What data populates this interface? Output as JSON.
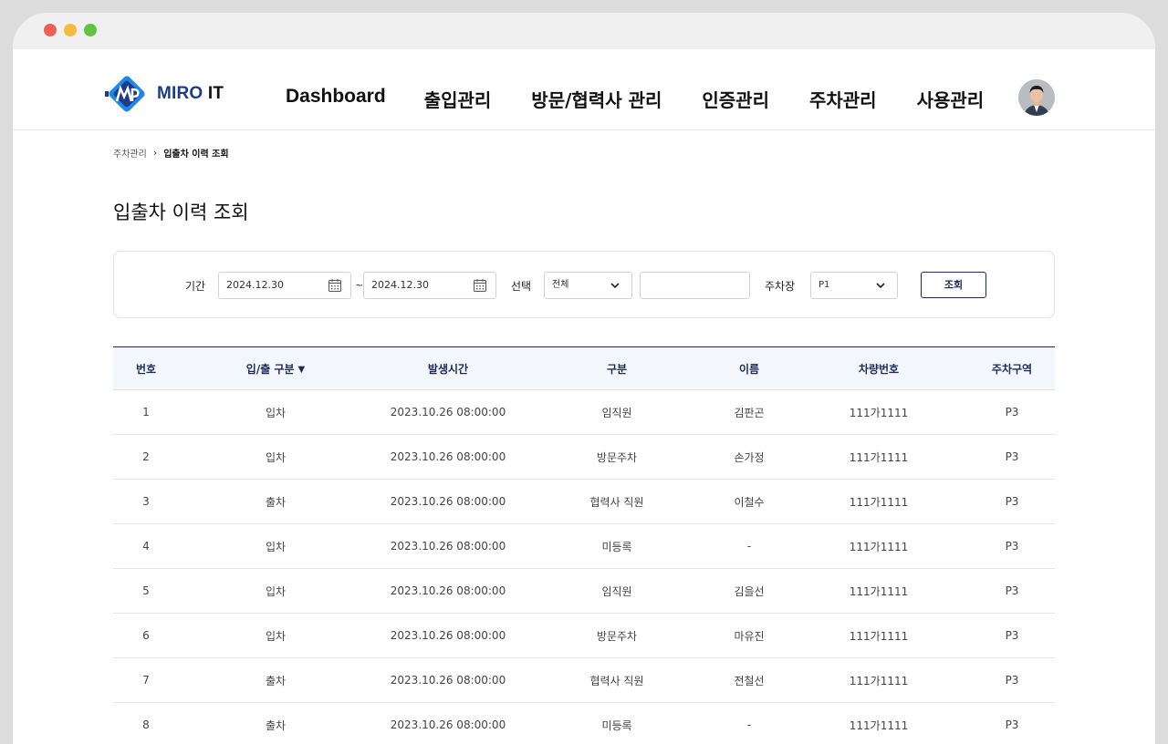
{
  "brand": {
    "name": "MIRO",
    "suffix": "IT"
  },
  "nav": {
    "items": [
      {
        "label": "Dashboard"
      },
      {
        "label": "출입관리"
      },
      {
        "label": "방문/협력사 관리"
      },
      {
        "label": "인증관리"
      },
      {
        "label": "주차관리"
      },
      {
        "label": "사용관리"
      }
    ]
  },
  "breadcrumb": {
    "parent": "주차관리",
    "current": "입출차 이력 조회"
  },
  "page_title": "입출차 이력 조회",
  "filter": {
    "period_label": "기간",
    "date_from": "2024.12.30",
    "date_separator": "~",
    "date_to": "2024.12.30",
    "select_label": "선택",
    "select_value": "전체",
    "keyword_value": "",
    "parking_label": "주차장",
    "parking_value": "P1",
    "search_button": "조회"
  },
  "table": {
    "columns": [
      "번호",
      "입/출 구분",
      "발생시간",
      "구분",
      "이름",
      "차량번호",
      "주차구역"
    ],
    "sort_indicator": "▼",
    "rows": [
      [
        "1",
        "입차",
        "2023.10.26 08:00:00",
        "임직원",
        "김판곤",
        "111가1111",
        "P3"
      ],
      [
        "2",
        "입차",
        "2023.10.26 08:00:00",
        "방문주차",
        "손가정",
        "111가1111",
        "P3"
      ],
      [
        "3",
        "출차",
        "2023.10.26 08:00:00",
        "협력사 직원",
        "이철수",
        "111가1111",
        "P3"
      ],
      [
        "4",
        "입차",
        "2023.10.26 08:00:00",
        "미등록",
        "-",
        "111가1111",
        "P3"
      ],
      [
        "5",
        "입차",
        "2023.10.26 08:00:00",
        "임직원",
        "김을선",
        "111가1111",
        "P3"
      ],
      [
        "6",
        "입차",
        "2023.10.26 08:00:00",
        "방문주차",
        "마유진",
        "111가1111",
        "P3"
      ],
      [
        "7",
        "출차",
        "2023.10.26 08:00:00",
        "협력사 직원",
        "전철선",
        "111가1111",
        "P3"
      ],
      [
        "8",
        "출차",
        "2023.10.26 08:00:00",
        "미등록",
        "-",
        "111가1111",
        "P3"
      ]
    ]
  },
  "colors": {
    "brand": "#1e3a8a",
    "accent": "#1e2a5a",
    "logo_blue": "#1e88e5"
  },
  "icons": [
    "calendar-icon",
    "chevron-down-icon",
    "sort-down-icon"
  ]
}
